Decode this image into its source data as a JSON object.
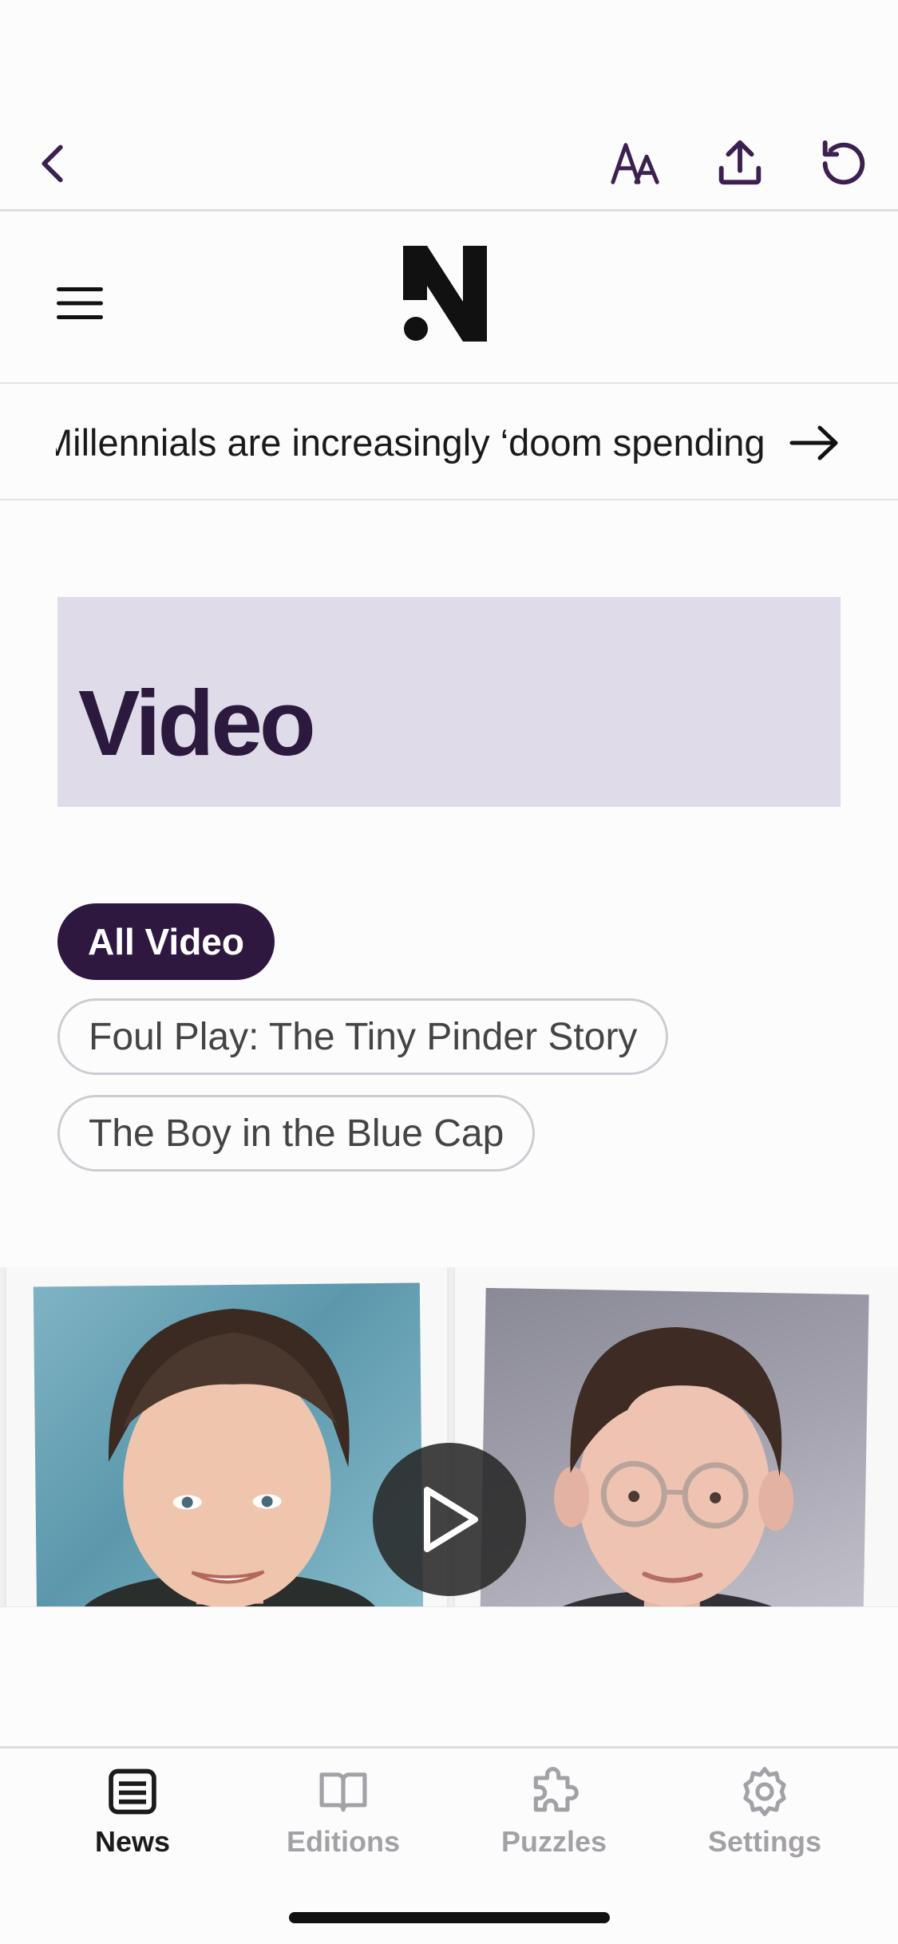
{
  "toolbar": {
    "back_icon": "chevron-left-icon",
    "text_size_icon": "text-size-icon",
    "share_icon": "share-icon",
    "refresh_icon": "refresh-icon",
    "accent_color": "#3b2050"
  },
  "masthead": {
    "menu_icon": "hamburger-menu-icon",
    "logo": "N"
  },
  "ticker": {
    "headline": "Millennials are increasingly ‘doom spending’",
    "arrow_icon": "arrow-right-icon"
  },
  "section": {
    "title": "Video",
    "banner_color": "#dfdbe8",
    "title_color": "#2c1a3e"
  },
  "filters": {
    "active": "All Video",
    "items": [
      "Foul Play: The Tiny Pinder Story",
      "The Boy in the Blue Cap"
    ]
  },
  "video": {
    "play_icon": "play-icon"
  },
  "tabbar": {
    "items": [
      {
        "label": "News",
        "icon": "newspaper-icon",
        "active": true
      },
      {
        "label": "Editions",
        "icon": "book-icon",
        "active": false
      },
      {
        "label": "Puzzles",
        "icon": "puzzle-icon",
        "active": false
      },
      {
        "label": "Settings",
        "icon": "gear-icon",
        "active": false
      }
    ]
  }
}
